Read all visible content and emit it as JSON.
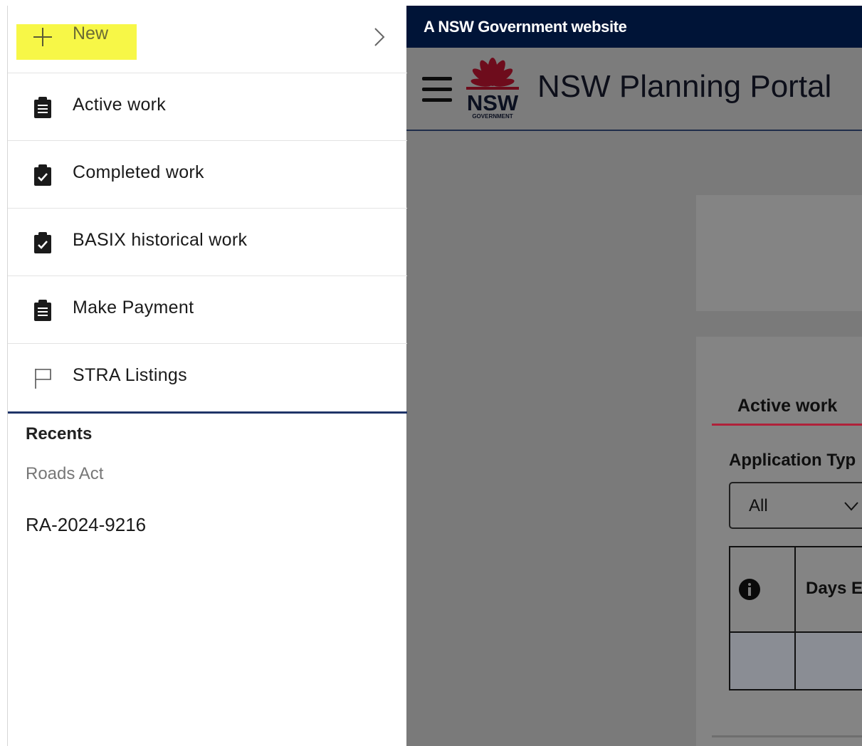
{
  "sidebar": {
    "new_item": {
      "label": "New",
      "icon": "plus-icon",
      "highlight_color": "#f7f747"
    },
    "items": [
      {
        "label": "Active work",
        "icon": "clipboard-icon"
      },
      {
        "label": "Completed work",
        "icon": "clipboard-check-icon"
      },
      {
        "label": "BASIX historical work",
        "icon": "clipboard-check-icon"
      },
      {
        "label": "Make Payment",
        "icon": "clipboard-icon"
      },
      {
        "label": "STRA Listings",
        "icon": "flag-icon"
      }
    ],
    "recents": {
      "heading": "Recents",
      "category": "Roads Act",
      "items": [
        "RA-2024-9216"
      ]
    }
  },
  "portal": {
    "gov_banner": "A NSW Government website",
    "title": "NSW Planning Portal",
    "logo": {
      "wordmark": "NSW",
      "subtext": "GOVERNMENT",
      "accent_color": "#d7153a"
    },
    "tabs": {
      "active_label": "Active work"
    },
    "filter": {
      "label": "Application Typ",
      "selected": "All"
    },
    "table": {
      "columns": [
        "",
        "Days E"
      ],
      "info_icon": "info-icon"
    },
    "colors": {
      "banner": "#002664",
      "tab_underline": "#b0213a",
      "divider": "#1f3468"
    }
  }
}
